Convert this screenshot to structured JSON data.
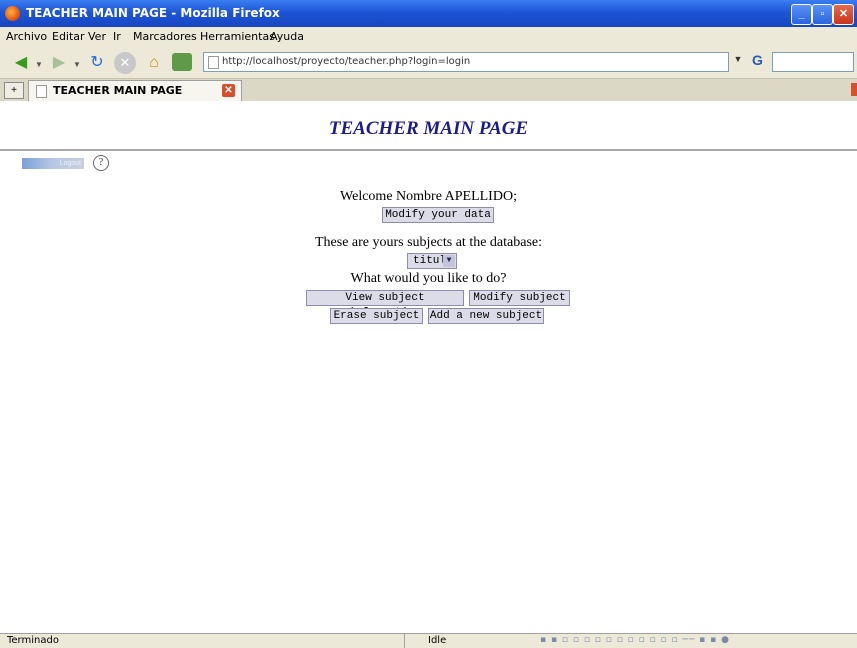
{
  "window": {
    "title": "TEACHER MAIN PAGE - Mozilla Firefox",
    "minimize_symbol": "_",
    "maximize_symbol": "▫",
    "close_symbol": "✕"
  },
  "menu": {
    "archivo": "Archivo",
    "editar": "Editar",
    "ver": "Ver",
    "ir": "Ir",
    "marcadores": "Marcadores",
    "herramientas": "Herramientas",
    "ayuda": "Ayuda"
  },
  "toolbar": {
    "url": "http://localhost/proyecto/teacher.php?login=login",
    "search_engine_icon": "G"
  },
  "tab": {
    "label": "TEACHER MAIN PAGE",
    "close_symbol": "✕"
  },
  "page": {
    "title": "TEACHER MAIN PAGE",
    "logout_label": "Logout",
    "help_symbol": "?",
    "welcome_text": "Welcome Nombre APELLIDO;",
    "modify_data_button": "Modify your data",
    "subjects_text": "These are yours subjects at the database:",
    "subject_select_value": "titulo",
    "question_text": "What would you like to do?",
    "buttons": {
      "view": "View subject information",
      "modify": "Modify subject",
      "erase": "Erase subject",
      "add": "Add a new subject"
    }
  },
  "status": {
    "left": "Terminado",
    "middle": "Idle"
  },
  "icons": {
    "back": "back-arrow-icon",
    "forward": "forward-arrow-icon",
    "reload": "reload-icon",
    "stop": "stop-icon",
    "home": "home-icon",
    "help": "help-icon"
  },
  "colors": {
    "title_bar": "#1d55d6",
    "page_title": "#1c1c8c",
    "button_bg": "#dcdce8"
  }
}
